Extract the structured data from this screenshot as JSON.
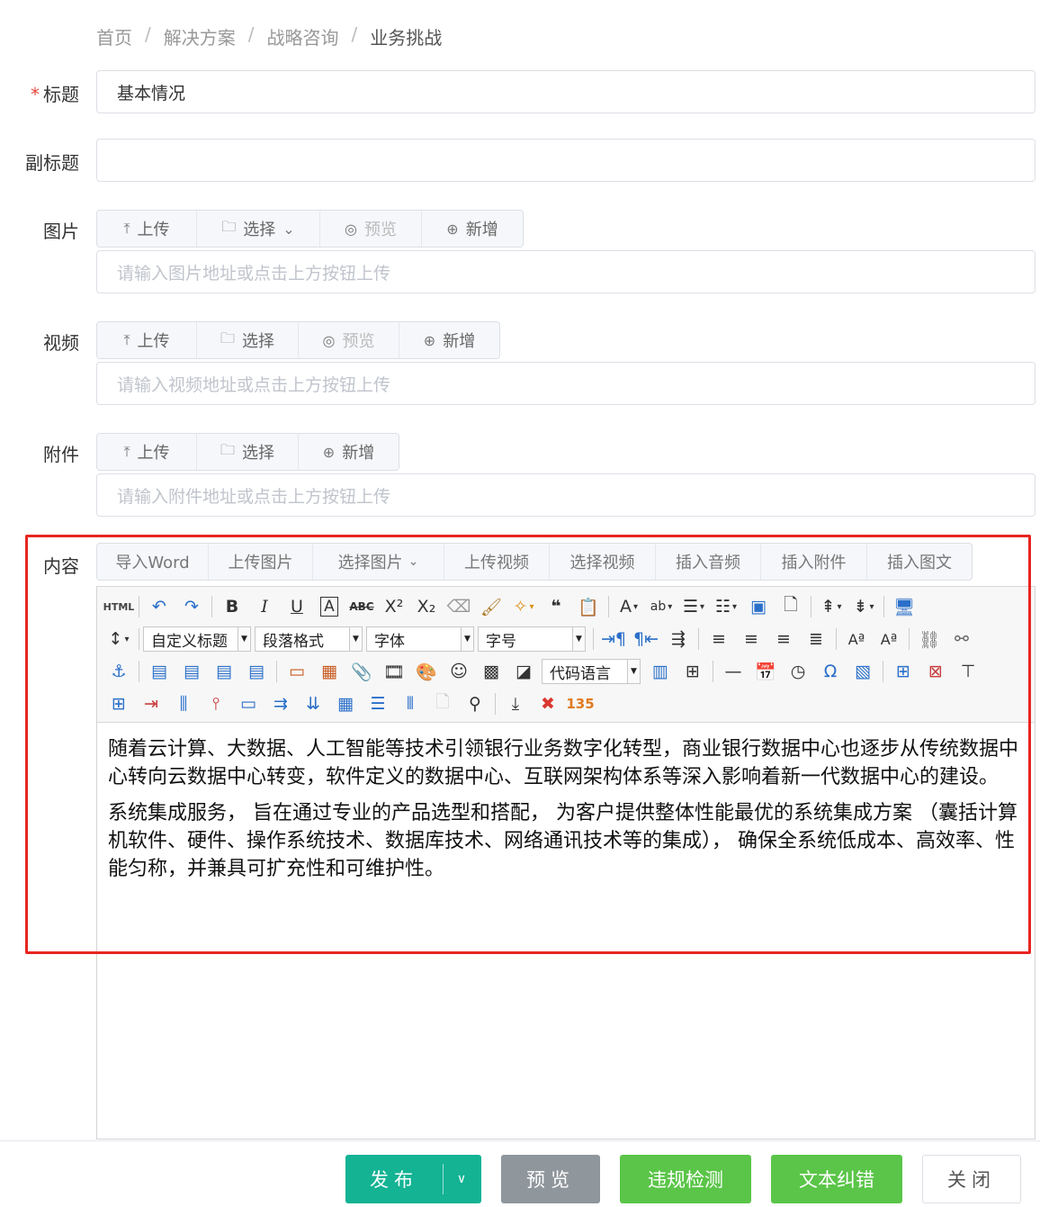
{
  "breadcrumb": [
    "首页",
    "解决方案",
    "战略咨询",
    "业务挑战"
  ],
  "form": {
    "title_label": "标题",
    "title_required_mark": "*",
    "title_value": "基本情况",
    "subtitle_label": "副标题",
    "subtitle_value": "",
    "image_label": "图片",
    "image_buttons": {
      "upload": "上传",
      "select": "选择",
      "preview": "预览",
      "add": "新增"
    },
    "image_placeholder": "请输入图片地址或点击上方按钮上传",
    "video_label": "视频",
    "video_buttons": {
      "upload": "上传",
      "select": "选择",
      "preview": "预览",
      "add": "新增"
    },
    "video_placeholder": "请输入视频地址或点击上方按钮上传",
    "attachment_label": "附件",
    "attachment_buttons": {
      "upload": "上传",
      "select": "选择",
      "add": "新增"
    },
    "attachment_placeholder": "请输入附件地址或点击上方按钮上传",
    "content_label": "内容"
  },
  "content_tabs": [
    "导入Word",
    "上传图片",
    "选择图片",
    "上传视频",
    "选择视频",
    "插入音频",
    "插入附件",
    "插入图文"
  ],
  "toolbar": {
    "html_label": "HTML",
    "custom_title": "自定义标题",
    "paragraph_format": "段落格式",
    "font": "字体",
    "font_size": "字号",
    "code_language": "代码语言"
  },
  "editor_body": [
    "随着云计算、大数据、人工智能等技术引领银行业务数字化转型，商业银行数据中心也逐步从传统数据中心转向云数据中心转变，软件定义的数据中心、互联网架构体系等深入影响着新一代数据中心的建设。",
    "系统集成服务， 旨在通过专业的产品选型和搭配， 为客户提供整体性能最优的系统集成方案 （囊括计算机软件、硬件、操作系统技术、数据库技术、网络通讯技术等的集成）， 确保全系统低成本、高效率、性能匀称，并兼具可扩充性和可维护性。"
  ],
  "footer": {
    "publish": "发布",
    "preview": "预览",
    "compliance_check": "违规检测",
    "text_correction": "文本纠错",
    "close": "关闭"
  },
  "colors": {
    "publish": "#13b394",
    "preview": "#8f969c",
    "green": "#5ac548",
    "highlight_frame": "#e8251f"
  }
}
